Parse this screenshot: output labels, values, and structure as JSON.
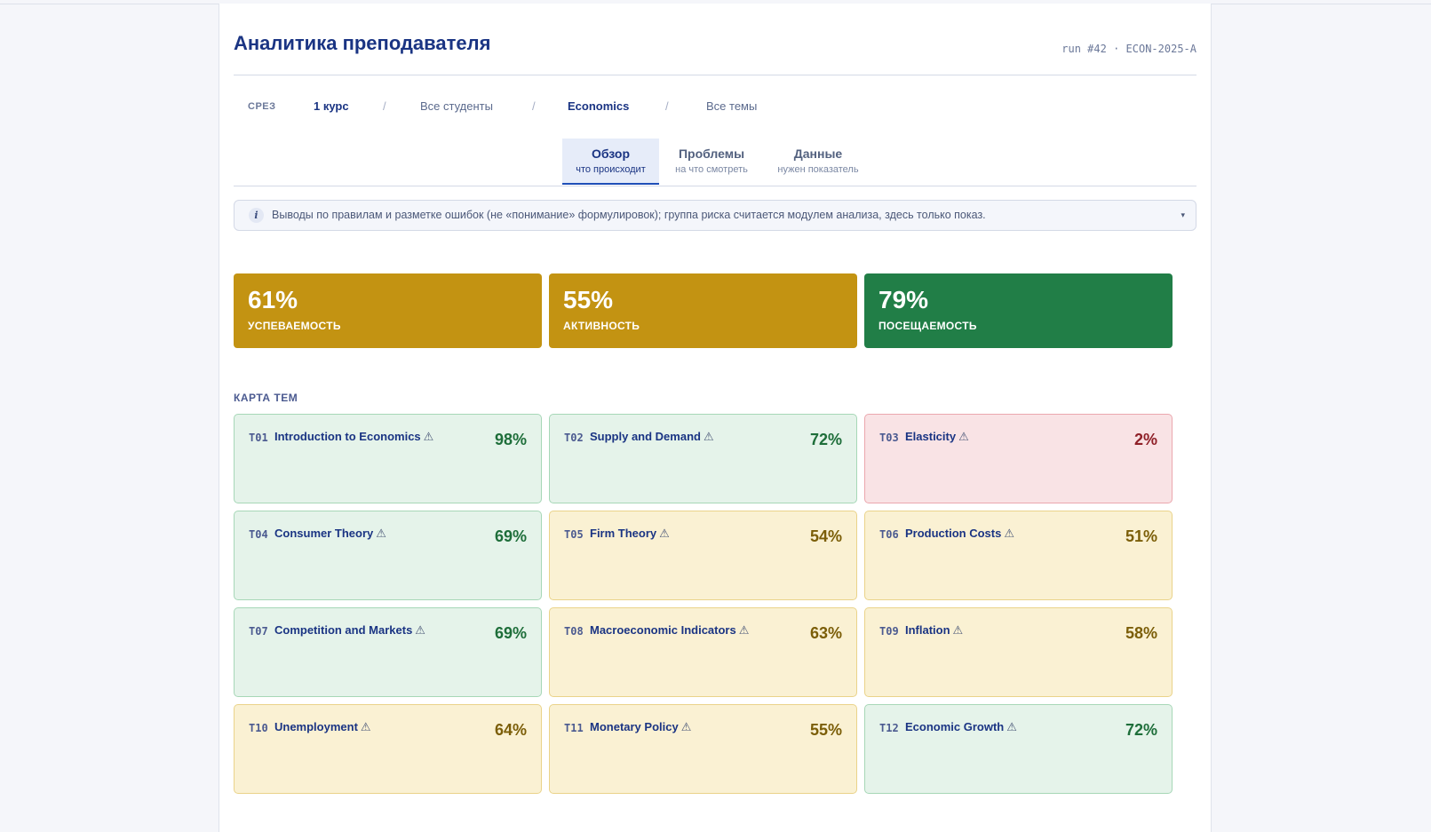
{
  "header": {
    "title": "Аналитика преподавателя",
    "run": "run #42 · ECON-2025-A"
  },
  "crumbs": {
    "label": "СРЕЗ",
    "course": "1 курс",
    "separator": "/",
    "students": "Все студенты",
    "subject": "Economics",
    "topics": "Все темы"
  },
  "tabs": [
    {
      "label": "Обзор",
      "sub": "что происходит",
      "active": true
    },
    {
      "label": "Проблемы",
      "sub": "на что смотреть",
      "active": false
    },
    {
      "label": "Данные",
      "sub": "нужен показатель",
      "active": false
    }
  ],
  "info": {
    "icon": "i",
    "text": "Выводы по правилам и разметке ошибок (не «понимание» формулировок); группа риска считается модулем анализа, здесь только показ.",
    "caret": "▾"
  },
  "kpis": [
    {
      "value": "61%",
      "label": "УСПЕВАЕМОСТЬ",
      "color": "#c39312"
    },
    {
      "value": "55%",
      "label": "АКТИВНОСТЬ",
      "color": "#c39312"
    },
    {
      "value": "79%",
      "label": "ПОСЕЩАЕМОСТЬ",
      "color": "#217e47"
    }
  ],
  "topic_map": {
    "title": "КАРТА ТЕМ",
    "warning_glyph": "⚠",
    "topics": [
      {
        "id": "T01",
        "name": "Introduction to Economics",
        "pct": "98%",
        "status": "green"
      },
      {
        "id": "T02",
        "name": "Supply and Demand",
        "pct": "72%",
        "status": "green"
      },
      {
        "id": "T03",
        "name": "Elasticity",
        "pct": "2%",
        "status": "red"
      },
      {
        "id": "T04",
        "name": "Consumer Theory",
        "pct": "69%",
        "status": "green"
      },
      {
        "id": "T05",
        "name": "Firm Theory",
        "pct": "54%",
        "status": "yellow"
      },
      {
        "id": "T06",
        "name": "Production Costs",
        "pct": "51%",
        "status": "yellow"
      },
      {
        "id": "T07",
        "name": "Competition and Markets",
        "pct": "69%",
        "status": "green"
      },
      {
        "id": "T08",
        "name": "Macroeconomic Indicators",
        "pct": "63%",
        "status": "yellow"
      },
      {
        "id": "T09",
        "name": "Inflation",
        "pct": "58%",
        "status": "yellow"
      },
      {
        "id": "T10",
        "name": "Unemployment",
        "pct": "64%",
        "status": "yellow"
      },
      {
        "id": "T11",
        "name": "Monetary Policy",
        "pct": "55%",
        "status": "yellow"
      },
      {
        "id": "T12",
        "name": "Economic Growth",
        "pct": "72%",
        "status": "green"
      }
    ]
  }
}
